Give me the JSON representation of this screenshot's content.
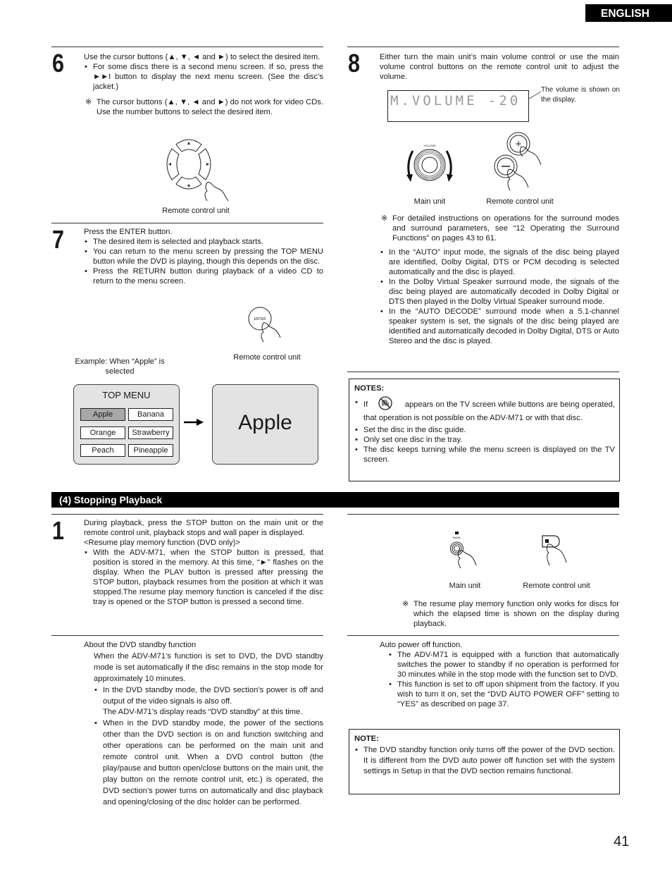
{
  "header": {
    "language_tab": "ENGLISH"
  },
  "page_number": "41",
  "step6": {
    "number": "6",
    "intro": "Use the cursor buttons (▲, ▼, ◄ and ►) to select the desired item.",
    "bullets": [
      "For some discs there is a second menu screen. If so, press the ►►I button to display the next menu screen. (See the disc’s jacket.)"
    ],
    "reference_note": "The cursor buttons (▲, ▼, ◄ and ►) do not work for video CDs. Use the number buttons to select the desired item.",
    "figure_caption": "Remote control unit",
    "figure_icon": "cursor-pad-icon"
  },
  "step7": {
    "number": "7",
    "intro": "Press the ENTER button.",
    "bullets": [
      "The desired item is selected and playback starts.",
      "You can return to the menu screen by pressing the TOP MENU button while the DVD is playing, though this depends on the disc.",
      "Press the RETURN button during playback of a video CD to return to the menu screen."
    ],
    "enter_button_label": "ENTER",
    "figure_caption": "Remote control unit",
    "example_caption": "Example: When “Apple” is selected",
    "top_menu": {
      "title": "TOP MENU",
      "items": [
        "Apple",
        "Banana",
        "Orange",
        "Strawberry",
        "Peach",
        "Pineapple"
      ],
      "selected": "Apple"
    },
    "result_screen_text": "Apple"
  },
  "step8": {
    "number": "8",
    "intro": "Either turn the main unit’s main volume control or use the main volume control buttons on the remote control unit to adjust the volume.",
    "display_text": "M.VOLUME -20",
    "display_callout": "The volume is shown on the display.",
    "volume_knob_label": "VOLUME",
    "main_unit_caption": "Main unit",
    "remote_caption": "Remote control unit",
    "reference_note": "For detailed instructions on operations for the surround modes and surround parameters, see “12 Operating the Surround Functions” on pages 43 to 61.",
    "bullets": [
      "In the “AUTO” input mode, the signals of the disc being played are identified, Dolby Digital, DTS or PCM decoding is selected automatically and the disc is played.",
      "In the Dolby Virtual Speaker surround mode, the signals of the disc being played are automatically decoded in Dolby Digital or DTS then played in the Dolby Virtual Speaker surround mode.",
      "In the “AUTO DECODE” surround mode when a 5.1-channel speaker system is set, the signals of the disc being played are identified and automatically decoded in Dolby Digital, DTS or Auto Stereo and the disc is played."
    ]
  },
  "notes": {
    "title": "NOTES:",
    "items": [
      {
        "before_icon": "If",
        "icon": "prohibited-hand-icon",
        "after_icon": "appears on the TV screen while buttons are being operated, that operation is not possible on the ADV-M71 or with that disc."
      },
      {
        "text": "Set the disc in the disc guide."
      },
      {
        "text": "Only set one disc in the tray."
      },
      {
        "text": "The disc keeps turning while the menu screen is displayed on the TV screen."
      }
    ]
  },
  "section": {
    "title": "(4) Stopping Playback"
  },
  "stop_step1": {
    "number": "1",
    "intro": "During playback, press the STOP button on the main unit or the remote control unit, playback stops and wall paper is displayed.",
    "subheading": "<Resume play memory function (DVD only)>",
    "bullets": [
      "With the ADV-M71, when the STOP button is pressed, that position is stored in the memory. At this time, “►” flashes on the display. When the PLAY button is pressed after pressing the STOP button, playback resumes from the position at which it was stopped.The resume play memory function is canceled if the disc tray is opened or the STOP button is pressed a second time."
    ],
    "band_label": "BAND",
    "main_unit_caption": "Main unit",
    "remote_caption": "Remote control unit",
    "reference_note": "The resume play memory function only works for discs for which the elapsed time is shown on the display during playback."
  },
  "standby": {
    "heading": "About the DVD standby function",
    "intro": "When the ADV-M71’s function is set to DVD, the DVD standby mode is set automatically if the disc remains in the stop mode for approximately 10 minutes.",
    "bullets": [
      {
        "text": "In the DVD standby mode, the DVD section’s power is off and output of the video signals is also off.",
        "extra": "The ADV-M71’s display reads “DVD standby” at this time."
      },
      {
        "text": "When in the DVD standby mode, the power of the sections other than the DVD section is on and function switching and other operations can be performed on the main unit and remote control unit. When a DVD control button (the play/pause and button open/close buttons on the main unit, the play button on the remote control unit, etc.) is operated, the DVD section’s power turns on automatically and disc playback and opening/closing of the disc holder can be performed."
      }
    ]
  },
  "auto_power_off": {
    "heading": "Auto power off function.",
    "bullets": [
      "The ADV-M71 is equipped with a function that automatically switches the power to standby if no operation is performed for 30 minutes while in the stop mode with the function set to DVD.",
      "This function is set to off upon shipment from the factory.  If you wish to turn it on, set the “DVD AUTO POWER OFF” setting to “YES” as described on page 37."
    ]
  },
  "note_box": {
    "title": "NOTE:",
    "items": [
      "The DVD standby function only turns off the power of the DVD section. It is different from the DVD auto power off function set with the system settings in Setup in that the DVD section remains functional."
    ]
  }
}
